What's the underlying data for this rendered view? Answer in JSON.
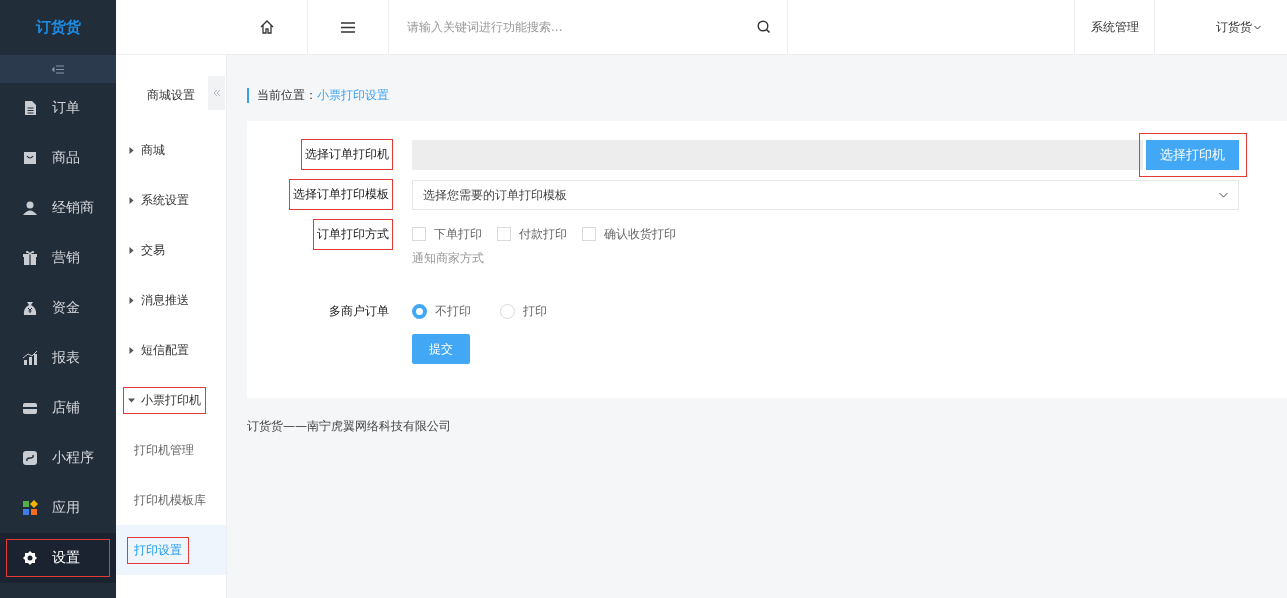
{
  "logo": "订货货",
  "nav": [
    {
      "label": "订单",
      "selected": false,
      "highlighted": false
    },
    {
      "label": "商品",
      "selected": false,
      "highlighted": false
    },
    {
      "label": "经销商",
      "selected": false,
      "highlighted": false
    },
    {
      "label": "营销",
      "selected": false,
      "highlighted": false
    },
    {
      "label": "资金",
      "selected": false,
      "highlighted": false
    },
    {
      "label": "报表",
      "selected": false,
      "highlighted": false
    },
    {
      "label": "店铺",
      "selected": false,
      "highlighted": false
    },
    {
      "label": "小程序",
      "selected": false,
      "highlighted": false
    },
    {
      "label": "应用",
      "selected": false,
      "highlighted": false
    },
    {
      "label": "设置",
      "selected": true,
      "highlighted": true
    }
  ],
  "submenu": {
    "title": "商城设置",
    "items": [
      {
        "label": "商城",
        "expanded": false,
        "highlighted": false
      },
      {
        "label": "系统设置",
        "expanded": false,
        "highlighted": false
      },
      {
        "label": "交易",
        "expanded": false,
        "highlighted": false
      },
      {
        "label": "消息推送",
        "expanded": false,
        "highlighted": false
      },
      {
        "label": "短信配置",
        "expanded": false,
        "highlighted": false
      },
      {
        "label": "小票打印机",
        "expanded": true,
        "highlighted": true,
        "children": [
          {
            "label": "打印机管理",
            "selected": false,
            "highlighted": false
          },
          {
            "label": "打印机模板库",
            "selected": false,
            "highlighted": false
          },
          {
            "label": "打印设置",
            "selected": true,
            "highlighted": true
          }
        ]
      }
    ]
  },
  "topbar": {
    "search_placeholder": "请输入关键词进行功能搜索...",
    "system": "系统管理",
    "user": "订货货"
  },
  "breadcrumb": {
    "prefix": "当前位置：",
    "current": "小票打印设置"
  },
  "form": [
    {
      "kind": "printer",
      "label": "选择订单打印机",
      "highlighted": true,
      "button": "选择打印机",
      "button_highlighted": true
    },
    {
      "kind": "select",
      "label": "选择订单打印模板",
      "highlighted": true,
      "placeholder": "选择您需要的订单打印模板"
    },
    {
      "kind": "checks",
      "label": "订单打印方式",
      "highlighted": true,
      "options": [
        {
          "label": "下单打印",
          "checked": false
        },
        {
          "label": "付款打印",
          "checked": false
        },
        {
          "label": "确认收货打印",
          "checked": false
        }
      ],
      "hint": "通知商家方式"
    },
    {
      "kind": "radios",
      "label": "多商户订单",
      "highlighted": false,
      "options": [
        {
          "label": "不打印",
          "selected": true
        },
        {
          "label": "打印",
          "selected": false
        }
      ]
    }
  ],
  "submit": "提交",
  "footer": "订货货——南宁虎翼网络科技有限公司"
}
